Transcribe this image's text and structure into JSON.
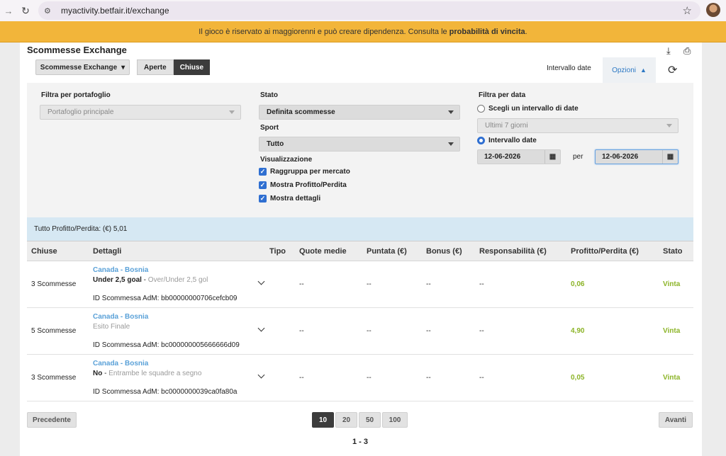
{
  "browser": {
    "url": "myactivity.betfair.it/exchange"
  },
  "banner": {
    "text": "Il gioco è riservato ai maggiorenni e può creare dipendenza. Consulta le",
    "link": "probabilità di vincita",
    "suffix": "."
  },
  "page": {
    "title": "Scommesse Exchange"
  },
  "toolbar": {
    "dropdown_label": "Scommesse Exchange",
    "tab_open": "Aperte",
    "tab_closed": "Chiuse",
    "date_interval_label": "Intervallo date",
    "options_label": "Opzioni"
  },
  "filters": {
    "portfolio_label": "Filtra per portafoglio",
    "portfolio_value": "Portafoglio principale",
    "status_label": "Stato",
    "status_value": "Definita scommesse",
    "sport_label": "Sport",
    "sport_value": "Tutto",
    "view_label": "Visualizzazione",
    "check_group": "Raggruppa per mercato",
    "check_pl": "Mostra Profitto/Perdita",
    "check_details": "Mostra dettagli",
    "date_label": "Filtra per data",
    "radio_choose": "Scegli un intervallo di date",
    "preset_value": "Ultimi 7 giorni",
    "radio_interval": "Intervallo date",
    "date_from": "12-06-2026",
    "per_label": "per",
    "date_to": "12-06-2026"
  },
  "summary": {
    "text": "Tutto Profitto/Perdita: (€) 5,01"
  },
  "table": {
    "headers": [
      "Chiuse",
      "Dettagli",
      "Tipo",
      "Quote medie",
      "Puntata (€)",
      "Bonus (€)",
      "Responsabilità (€)",
      "Profitto/Perdita (€)",
      "Stato"
    ],
    "rows": [
      {
        "count": "3 Scommesse",
        "event": "Canada - Bosnia",
        "selection": "Under 2,5 goal",
        "separator": " - ",
        "market": "Over/Under 2,5 gol",
        "id_text": "ID Scommessa AdM: bb00000000706cefcb09",
        "odds": "--",
        "stake": "--",
        "bonus": "--",
        "liability": "--",
        "pl": "0,06",
        "status": "Vinta"
      },
      {
        "count": "5 Scommesse",
        "event": "Canada - Bosnia",
        "selection": "",
        "separator": "",
        "market": "Esito Finale",
        "id_text": "ID Scommessa AdM: bc000000005666666d09",
        "odds": "--",
        "stake": "--",
        "bonus": "--",
        "liability": "--",
        "pl": "4,90",
        "status": "Vinta"
      },
      {
        "count": "3 Scommesse",
        "event": "Canada - Bosnia",
        "selection": "No",
        "separator": " - ",
        "market": "Entrambe le squadre a segno",
        "id_text": "ID Scommessa AdM: bc0000000039ca0fa80a",
        "odds": "--",
        "stake": "--",
        "bonus": "--",
        "liability": "--",
        "pl": "0,05",
        "status": "Vinta"
      }
    ]
  },
  "pagination": {
    "prev": "Precedente",
    "next": "Avanti",
    "sizes": [
      "10",
      "20",
      "50",
      "100"
    ],
    "range": "1 - 3"
  }
}
